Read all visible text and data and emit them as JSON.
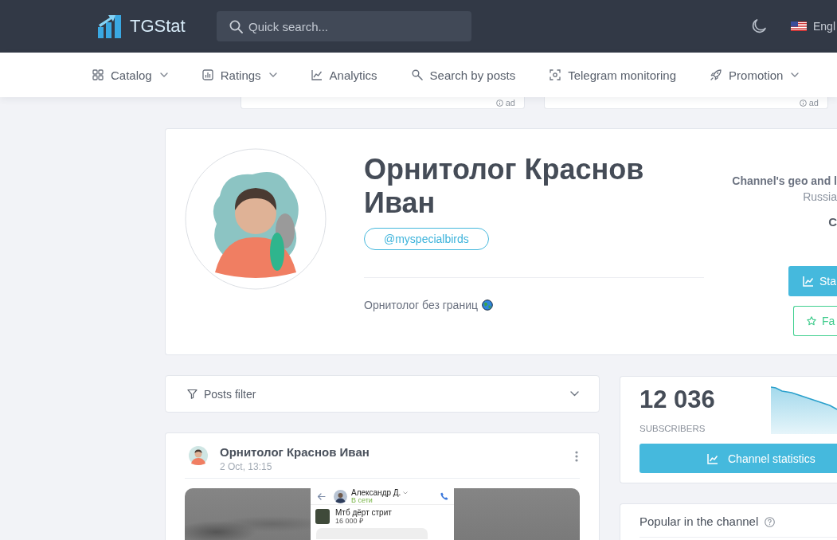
{
  "header": {
    "logo": "TGStat",
    "search": {
      "placeholder": "Quick search..."
    },
    "language": "Engl"
  },
  "nav": [
    {
      "label": "Catalog",
      "dropdown": true
    },
    {
      "label": "Ratings",
      "dropdown": true
    },
    {
      "label": "Analytics",
      "dropdown": false
    },
    {
      "label": "Search by posts",
      "dropdown": false
    },
    {
      "label": "Telegram monitoring",
      "dropdown": false
    },
    {
      "label": "Promotion",
      "dropdown": true
    }
  ],
  "ads": [
    {
      "label": "ad"
    },
    {
      "label": "ad"
    }
  ],
  "channel": {
    "title": "Орнитолог Краснов Иван",
    "username": "@myspecialbirds",
    "description": "Орнитолог без границ",
    "geo_heading": "Channel's geo and l",
    "geo_value": "Russia",
    "category": "C",
    "buttons": [
      {
        "label": "Sta",
        "kind": "primary"
      },
      {
        "label": "Fa",
        "kind": "outline"
      }
    ]
  },
  "posts_filter": {
    "label": "Posts filter"
  },
  "post": {
    "author": "Орнитолог Краснов Иван",
    "date": "2 Oct, 13:15",
    "screenshot": {
      "contact": "Александр Д.",
      "status": "В сети",
      "item_title": "Мтб дёрт стрит",
      "item_price": "16 000 ₽"
    }
  },
  "subscribers": {
    "count": "12 036",
    "label": "SUBSCRIBERS",
    "button": "Channel statistics"
  },
  "popular": {
    "title": "Popular in the channel"
  }
}
